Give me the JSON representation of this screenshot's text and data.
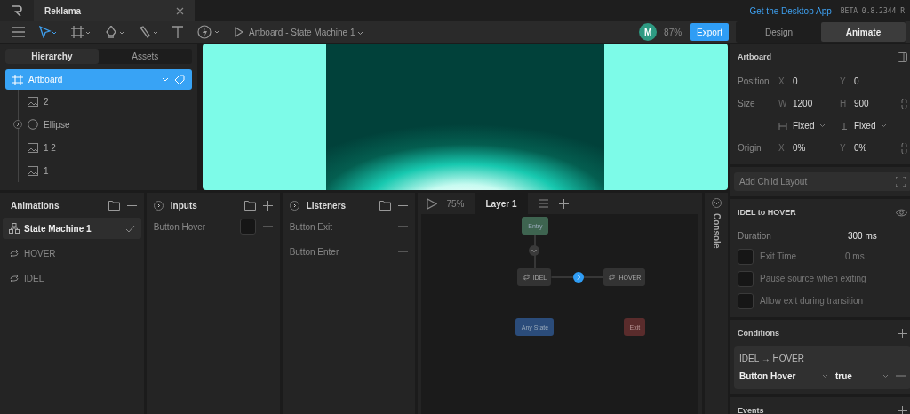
{
  "app_tabs": [
    {
      "label": "Reklama",
      "selected": true
    }
  ],
  "top_bar": {
    "link": "Get the Desktop App",
    "version": "BETA 0.8.2344 R"
  },
  "toolbar": {
    "breadcrumb": "Artboard - State Machine 1",
    "avatar": "M",
    "zoom": "87%",
    "export": "Export",
    "modes": [
      {
        "label": "Design",
        "selected": false
      },
      {
        "label": "Animate",
        "selected": true
      }
    ]
  },
  "left_panel": {
    "tabs": [
      {
        "label": "Hierarchy",
        "selected": true
      },
      {
        "label": "Assets",
        "selected": false
      }
    ],
    "tree": [
      {
        "label": "Artboard",
        "kind": "artboard",
        "selected": true,
        "expanded": true,
        "children": [
          {
            "label": "2",
            "kind": "image",
            "selected": false
          },
          {
            "label": "Ellipse",
            "kind": "ellipse",
            "selected": false,
            "expanded": false
          },
          {
            "label": "1 2",
            "kind": "image",
            "selected": false
          },
          {
            "label": "1",
            "kind": "image",
            "selected": false
          }
        ]
      }
    ]
  },
  "animations": {
    "title": "Animations",
    "items": [
      {
        "label": "State Machine 1",
        "kind": "state-machine",
        "selected": true
      },
      {
        "label": "HOVER",
        "kind": "loop",
        "selected": false
      },
      {
        "label": "IDEL",
        "kind": "loop",
        "selected": false
      }
    ]
  },
  "inputs": {
    "title": "Inputs",
    "items": [
      {
        "label": "Button Hover",
        "checked": false
      }
    ]
  },
  "listeners": {
    "title": "Listeners",
    "items": [
      {
        "label": "Button Exit"
      },
      {
        "label": "Button Enter"
      }
    ]
  },
  "graph": {
    "zoom": "75%",
    "layers": [
      {
        "label": "Layer 1",
        "selected": true
      }
    ],
    "nodes": [
      {
        "label": "Entry",
        "kind": "entry"
      },
      {
        "label": "IDEL",
        "kind": "state"
      },
      {
        "label": "HOVER",
        "kind": "state"
      },
      {
        "label": "Any State",
        "kind": "any"
      },
      {
        "label": "Exit",
        "kind": "exit"
      }
    ]
  },
  "console": {
    "label": "Console"
  },
  "inspector": {
    "title": "Artboard",
    "rows": [
      {
        "label": "Position",
        "fields": [
          {
            "prefix": "X",
            "value": "0"
          },
          {
            "prefix": "Y",
            "value": "0"
          }
        ]
      },
      {
        "label": "Size",
        "fields": [
          {
            "prefix": "W",
            "value": "1200"
          },
          {
            "prefix": "H",
            "value": "900"
          }
        ]
      },
      {
        "fields": [
          {
            "value": "Fixed"
          },
          {
            "value": "Fixed"
          }
        ]
      },
      {
        "label": "Origin",
        "fields": [
          {
            "prefix": "X",
            "value": "0%"
          },
          {
            "prefix": "Y",
            "value": "0%"
          }
        ]
      }
    ],
    "child_layout": "Add Child Layout"
  },
  "transition": {
    "title": "IDEL to HOVER",
    "duration_label": "Duration",
    "duration": "300 ms",
    "options": [
      {
        "label": "Exit Time",
        "value": "0 ms",
        "checked": false
      },
      {
        "label": "Pause source when exiting",
        "checked": false
      },
      {
        "label": "Allow exit during transition",
        "checked": false
      }
    ]
  },
  "conditions": {
    "title": "Conditions",
    "heading": "IDEL → HOVER",
    "input": "Button Hover",
    "value": "true"
  },
  "events": {
    "title": "Events"
  }
}
